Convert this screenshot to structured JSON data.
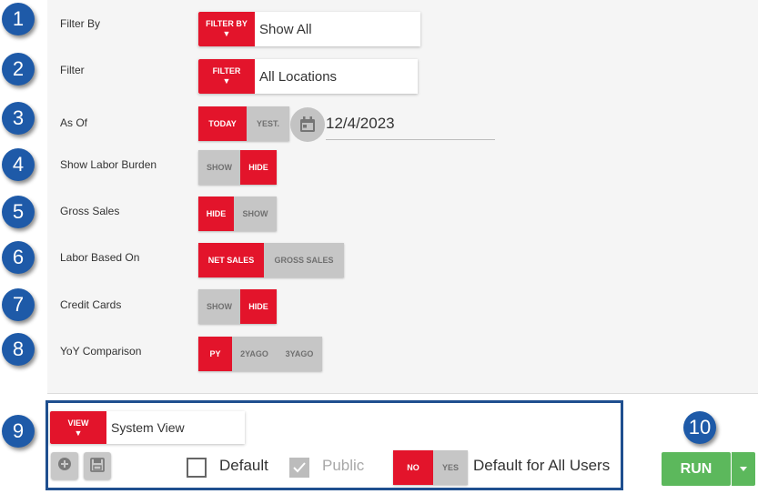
{
  "badges": [
    "1",
    "2",
    "3",
    "4",
    "5",
    "6",
    "7",
    "8",
    "9",
    "10"
  ],
  "filter_by": {
    "label": "Filter By",
    "button": "FILTER BY",
    "arrow": "▼",
    "value": "Show All"
  },
  "filter": {
    "label": "Filter",
    "button": "FILTER",
    "arrow": "▼",
    "value": "All Locations"
  },
  "as_of": {
    "label": "As Of",
    "options": [
      "TODAY",
      "YEST."
    ],
    "selected": "TODAY",
    "date": "12/4/2023",
    "icon": "calendar-icon"
  },
  "labor_burden": {
    "label": "Show Labor Burden",
    "options": [
      "SHOW",
      "HIDE"
    ],
    "selected": "HIDE"
  },
  "gross_sales": {
    "label": "Gross Sales",
    "options": [
      "HIDE",
      "SHOW"
    ],
    "selected": "HIDE"
  },
  "labor_based_on": {
    "label": "Labor Based On",
    "options": [
      "NET SALES",
      "GROSS SALES"
    ],
    "selected": "NET SALES"
  },
  "credit_cards": {
    "label": "Credit Cards",
    "options": [
      "SHOW",
      "HIDE"
    ],
    "selected": "HIDE"
  },
  "yoy": {
    "label": "YoY Comparison",
    "options": [
      "PY",
      "2YAGO",
      "3YAGO"
    ],
    "selected": "PY"
  },
  "view": {
    "button": "VIEW",
    "arrow": "▼",
    "value": "System View",
    "default_label": "Default",
    "default_checked": false,
    "public_label": "Public",
    "public_checked": true,
    "all_users_options": [
      "NO",
      "YES"
    ],
    "all_users_selected": "NO",
    "all_users_label": "Default for All Users"
  },
  "run": {
    "label": "RUN"
  },
  "colors": {
    "accent": "#e3142b",
    "badge": "#1e5aa8",
    "run": "#5cb85c",
    "inactive": "#c6c6c6"
  }
}
